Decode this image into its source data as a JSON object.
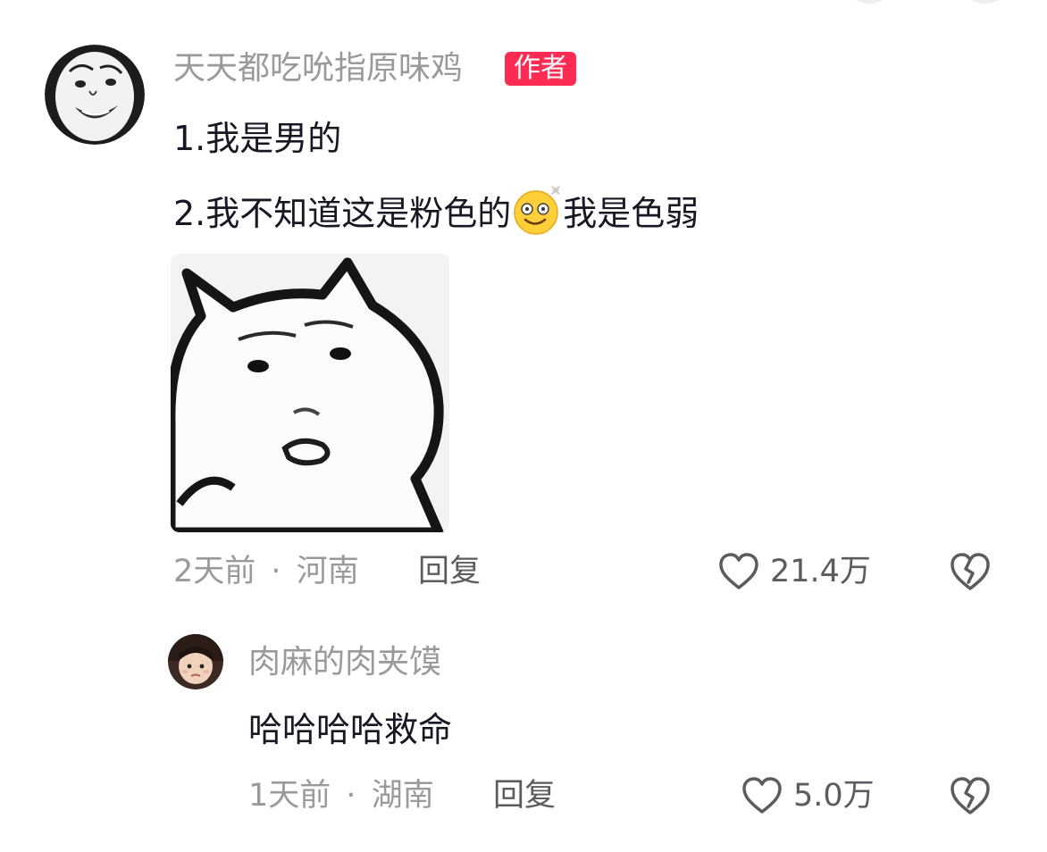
{
  "comment": {
    "username": "天天都吃吮指原味鸡",
    "badge": "作者",
    "lines": [
      "1.我是男的",
      "2.我不知道这是粉色的"
    ],
    "line2_suffix": "我是色弱",
    "emoji_icon": "smiling-dizzy-emoji-icon",
    "sticker_icon": "cat-face-sticker",
    "time": "2天前",
    "separator": "·",
    "location": "河南",
    "reply_label": "回复",
    "like_count": "21.4万"
  },
  "reply": {
    "username": "肉麻的肉夹馍",
    "text": "哈哈哈哈救命",
    "time": "1天前",
    "separator": "·",
    "location": "湖南",
    "reply_label": "回复",
    "like_count": "5.0万"
  },
  "icons": {
    "like": "heart-outline-icon",
    "dislike": "broken-heart-icon"
  },
  "colors": {
    "badge_bg": "#fe2c55",
    "meta_text": "#9a9a9e",
    "action_text": "#5b5b60",
    "body_text": "#161823"
  }
}
